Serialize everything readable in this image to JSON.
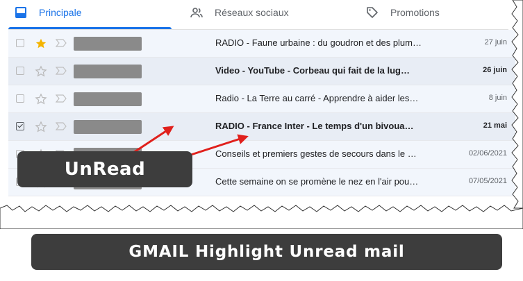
{
  "tabs": [
    {
      "label": "Principale",
      "icon": "inbox-icon",
      "active": true
    },
    {
      "label": "Réseaux sociaux",
      "icon": "people-icon",
      "active": false
    },
    {
      "label": "Promotions",
      "icon": "tag-icon",
      "active": false
    }
  ],
  "emails": [
    {
      "subject": "RADIO - Faune urbaine : du goudron et des plum…",
      "date": "27 juin",
      "unread": false,
      "starred": true,
      "selected": false
    },
    {
      "subject": "Video - YouTube - Corbeau qui fait de la lug…",
      "date": "26 juin",
      "unread": true,
      "starred": false,
      "selected": false
    },
    {
      "subject": "Radio - La Terre au carré - Apprendre à aider les…",
      "date": "8 juin",
      "unread": false,
      "starred": false,
      "selected": false
    },
    {
      "subject": "RADIO - France Inter - Le temps d'un bivoua…",
      "date": "21 mai",
      "unread": true,
      "starred": false,
      "selected": true
    },
    {
      "subject": "Conseils et premiers gestes de secours dans le …",
      "date": "02/06/2021",
      "unread": false,
      "starred": false,
      "selected": false
    },
    {
      "subject": "Cette semaine on se promène le nez en l'air pou…",
      "date": "07/05/2021",
      "unread": false,
      "starred": false,
      "selected": false
    }
  ],
  "annotation": {
    "label": "UnRead",
    "color": "#e0201c"
  },
  "caption": "GMAIL Highlight Unread mail",
  "colors": {
    "accent": "#1a73e8",
    "star": "#f4b400",
    "unread_bg": "#e8edf5",
    "read_bg": "#f2f6fc",
    "overlay": "#3d3d3d"
  }
}
